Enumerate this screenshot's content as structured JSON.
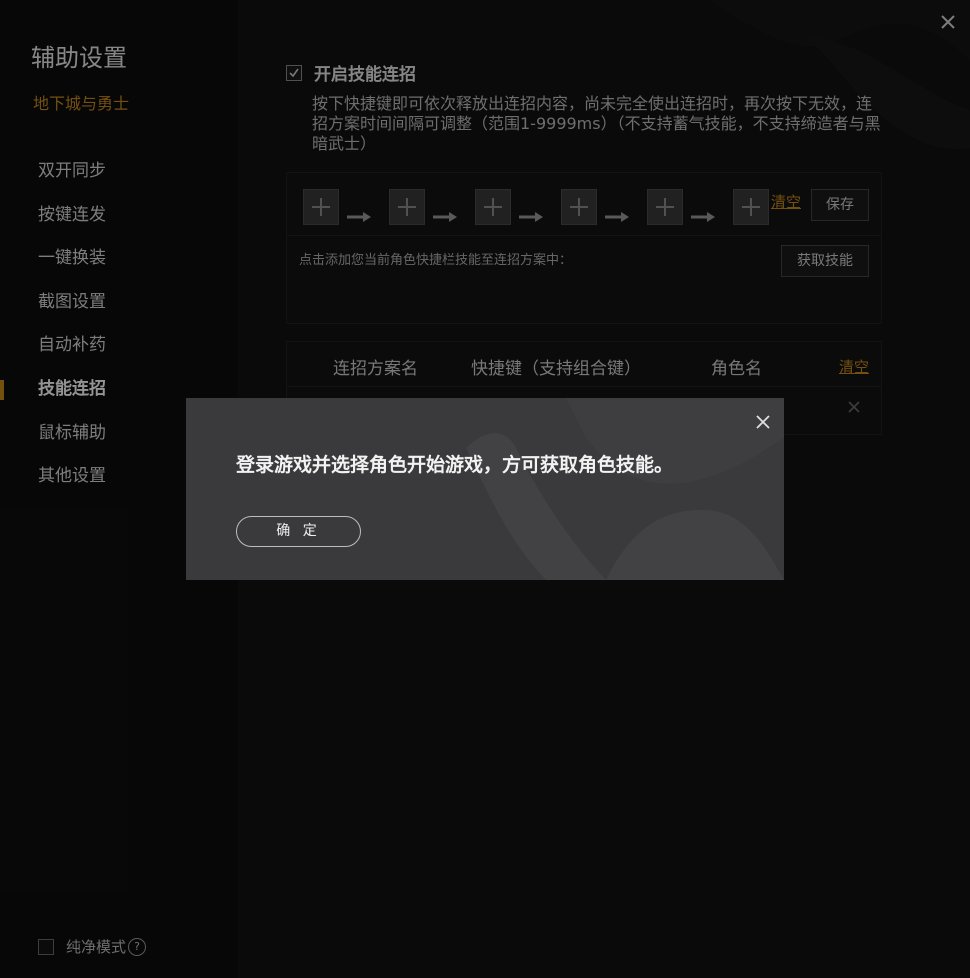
{
  "sidebar": {
    "title": "辅助设置",
    "subtitle": "地下城与勇士",
    "items": [
      {
        "label": "双开同步"
      },
      {
        "label": "按键连发"
      },
      {
        "label": "一键换装"
      },
      {
        "label": "截图设置"
      },
      {
        "label": "自动补药"
      },
      {
        "label": "技能连招",
        "active": true
      },
      {
        "label": "鼠标辅助"
      },
      {
        "label": "其他设置"
      }
    ],
    "pure_mode_label": "纯净模式",
    "help_glyph": "?"
  },
  "main": {
    "enable_label": "开启技能连招",
    "description": "按下快捷键即可依次释放出连招内容，尚未完全使出连招时，再次按下无效，连招方案时间间隔可调整（范围1-9999ms）（不支持蓄气技能，不支持缔造者与黑暗武士）",
    "combo": {
      "slot_count": 6,
      "clear_label": "清空",
      "save_label": "保存",
      "hint": "点击添加您当前角色快捷栏技能至连招方案中：",
      "fetch_label": "获取技能"
    },
    "table": {
      "headers": [
        "连招方案名",
        "快捷键（支持组合键）",
        "角色名"
      ],
      "clear_label": "清空"
    }
  },
  "modal": {
    "message": "登录游戏并选择角色开始游戏，方可获取角色技能。",
    "ok_label": "确 定"
  },
  "colors": {
    "accent": "#c98a1a",
    "modal_bg": "#3a3a3c",
    "main_bg": "#121212",
    "sidebar_bg": "#0d0d0d"
  },
  "icons": {
    "close": "close-icon",
    "check": "check-icon",
    "add": "plus-icon",
    "arrow": "arrow-right-icon",
    "delete": "delete-x-icon"
  }
}
